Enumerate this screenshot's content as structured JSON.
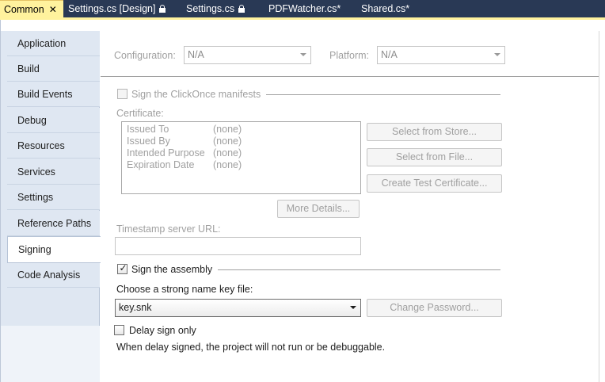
{
  "tabs": [
    {
      "label": "Common",
      "active": true,
      "close": "✕"
    },
    {
      "label": "Settings.cs [Design]",
      "locked": true
    },
    {
      "label": "Settings.cs",
      "locked": true
    },
    {
      "label": "PDFWatcher.cs*"
    },
    {
      "label": "Shared.cs*"
    }
  ],
  "nav": {
    "items": [
      {
        "label": "Application"
      },
      {
        "label": "Build"
      },
      {
        "label": "Build Events"
      },
      {
        "label": "Debug"
      },
      {
        "label": "Resources"
      },
      {
        "label": "Services"
      },
      {
        "label": "Settings"
      },
      {
        "label": "Reference Paths"
      },
      {
        "label": "Signing",
        "active": true
      },
      {
        "label": "Code Analysis"
      }
    ]
  },
  "config": {
    "configuration_label": "Configuration:",
    "configuration_value": "N/A",
    "platform_label": "Platform:",
    "platform_value": "N/A"
  },
  "clickonce": {
    "sign_label": "Sign the ClickOnce manifests",
    "sign_checked": false,
    "certificate_label": "Certificate:",
    "fields": [
      {
        "key": "Issued To",
        "value": "(none)"
      },
      {
        "key": "Issued By",
        "value": "(none)"
      },
      {
        "key": "Intended Purpose",
        "value": "(none)"
      },
      {
        "key": "Expiration Date",
        "value": "(none)"
      }
    ],
    "select_store_button": "Select from Store...",
    "select_file_button": "Select from File...",
    "create_test_button": "Create Test Certificate...",
    "more_details_button": "More Details...",
    "timestamp_label": "Timestamp server URL:",
    "timestamp_value": ""
  },
  "assembly": {
    "sign_label": "Sign the assembly",
    "sign_checked": true,
    "check_glyph": "✓",
    "keyfile_label": "Choose a strong name key file:",
    "keyfile_value": "key.snk",
    "change_password_button": "Change Password...",
    "delay_label": "Delay sign only",
    "delay_checked": false,
    "delay_note": "When delay signed, the project will not run or be debuggable."
  },
  "colors": {
    "tab_strip": "#293955",
    "active_tab": "#fff29d",
    "nav_background": "#dfe7f2",
    "disabled_text": "#a0a0a0"
  }
}
